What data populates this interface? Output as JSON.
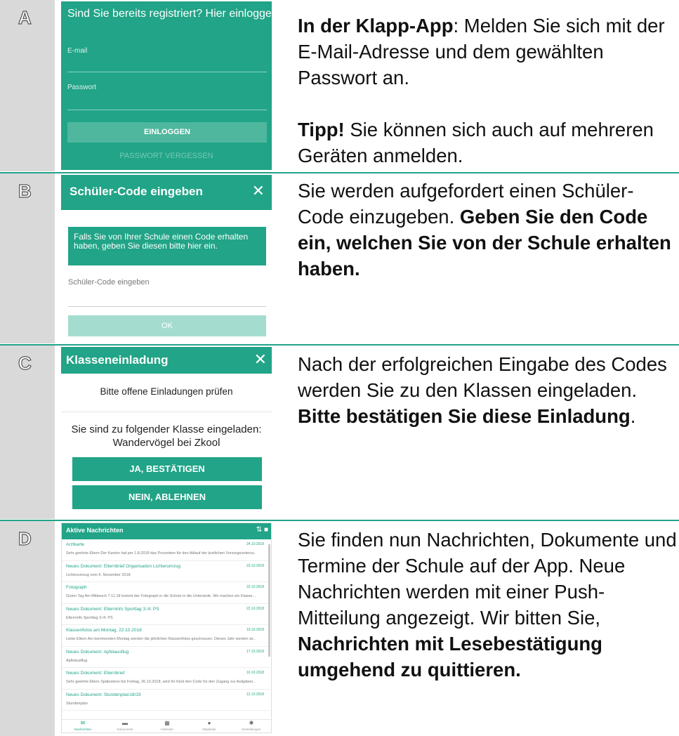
{
  "rows": {
    "a": {
      "label": "A",
      "screen": {
        "heading": "Sind Sie bereits registriert? Hier einloggen:",
        "email_label": "E-mail",
        "password_label": "Passwort",
        "login_button": "EINLOGGEN",
        "forgot_link": "PASSWORT VERGESSEN"
      },
      "desc": {
        "p1_bold": "In der Klapp-App",
        "p1_rest": ": Melden Sie sich mit der E-Mail-Adresse und dem gewählten Passwort an.",
        "p2_bold": "Tipp!",
        "p2_rest": " Sie können sich auch auf mehreren Geräten anmelden."
      }
    },
    "b": {
      "label": "B",
      "screen": {
        "title": "Schüler-Code eingeben",
        "close": "✕",
        "info": "Falls Sie von Ihrer Schule einen Code erhalten haben, geben Sie diesen bitte hier ein.",
        "input_label": "Schüler-Code eingeben",
        "ok_button": "OK"
      },
      "desc": {
        "p1_rest": "Sie werden aufgefordert einen Schüler-Code einzugeben. ",
        "p1_bold": "Geben Sie den Code ein, welchen Sie von der Schule erhalten haben."
      }
    },
    "c": {
      "label": "C",
      "screen": {
        "title": "Klasseneinladung",
        "close": "✕",
        "subtitle": "Bitte offene Einladungen prüfen",
        "message": "Sie sind zu folgender Klasse eingeladen: Wandervögel bei Zkool",
        "confirm_button": "JA, BESTÄTIGEN",
        "decline_button": "NEIN, ABLEHNEN"
      },
      "desc": {
        "p1_rest": "Nach der erfolgreichen Eingabe des Codes werden Sie zu den Klassen eingeladen. ",
        "p1_bold": "Bitte bestätigen Sie diese Einladung",
        "p1_end": "."
      }
    },
    "d": {
      "label": "D",
      "screen": {
        "title": "Aktive Nachrichten",
        "header_icons": "⇅ ■",
        "items": [
          {
            "title": "Arztkarte",
            "snippet": "Sehr geehrte Eltern Der Kanton hat per 1.8.2018 das Prozedere für den Ablauf der ärztlichen Vorsorgeuntersu...",
            "date": "24.10.2018"
          },
          {
            "title": "Neues Dokument: Elternbrief Organisation Lichterumzug",
            "snippet": "Lichterumzug vom 6. November 2018",
            "date": "23.10.2018"
          },
          {
            "title": "Fotograph",
            "snippet": "Guten Tag Am Mittwoch 7.11.18 kommt der Fotograph in die Schule in die Unterstufe. Wir machen ein Klasse...",
            "date": "22.10.2018"
          },
          {
            "title": "Neues Dokument: Elterninfo Sporttag 3./4. PS",
            "snippet": "Elterninfo Sporttag 3./4. PS",
            "date": "22.10.2018"
          },
          {
            "title": "Klassenfotos am Montag, 22.10.2018",
            "snippet": "Liebe Eltern Am kommenden Montag werden die jährlichen Klassenfotos geschossen. Dieses Jahr werden wi...",
            "date": "19.10.2018"
          },
          {
            "title": "Neues Dokument: Apfelausflug",
            "snippet": "Apfelausflug",
            "date": "17.10.2018"
          },
          {
            "title": "Neues Dokument: Elternbrief",
            "snippet": "Sehr geehrte Eltern Spätestens bis Freitag, 26.10.2018, wird Ihr Kind den Code für den Zugang zur Aufgaben...",
            "date": "16.10.2018"
          },
          {
            "title": "Neues Dokument: Stundenplan18/19",
            "snippet": "Stundenplan",
            "date": "12.10.2018"
          }
        ],
        "nav": [
          {
            "icon": "✉",
            "label": "Nachrichten"
          },
          {
            "icon": "▬",
            "label": "Dokumente"
          },
          {
            "icon": "▦",
            "label": "Kalender"
          },
          {
            "icon": "●",
            "label": "Mitglieder"
          },
          {
            "icon": "✱",
            "label": "Einstellungen"
          }
        ]
      },
      "desc": {
        "p1_rest": "Sie finden nun Nachrichten, Dokumente und Termine der Schule auf der App. Neue Nachrichten werden mit einer Push-Mitteilung angezeigt. Wir bitten Sie, ",
        "p1_bold": "Nachrichten mit Lesebestätigung umgehend zu quittieren."
      }
    }
  }
}
